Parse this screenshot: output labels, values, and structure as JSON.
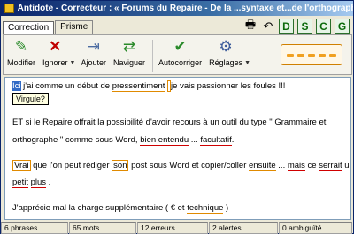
{
  "window": {
    "title": "Antidote - Correcteur : « Forums du Repaire - De la ...syntaxe et...de l'orthographe..."
  },
  "tabs": [
    {
      "label": "Correction"
    },
    {
      "label": "Prisme"
    }
  ],
  "toolbar": {
    "buttons": [
      {
        "label": "Modifier",
        "icon": "modify-icon"
      },
      {
        "label": "Ignorer",
        "icon": "ignore-icon"
      },
      {
        "label": "Ajouter",
        "icon": "add-icon"
      },
      {
        "label": "Naviguer",
        "icon": "navigate-icon"
      },
      {
        "label": "Autocorriger",
        "icon": "autocorrect-icon"
      },
      {
        "label": "Réglages",
        "icon": "settings-icon"
      }
    ]
  },
  "dscg": [
    "D",
    "S",
    "C",
    "G"
  ],
  "editor": {
    "tooltip": "Virgule?",
    "l1": {
      "sel": "Ici",
      "a": " j'ai comme un début de ",
      "b": "pressentiment",
      "c": " ",
      "d": "je vais passionner les foules !!!"
    },
    "l2": {
      "a": "ET si le Repaire offrait la possibilité d'avoir recours à un outil du type \" Grammaire et"
    },
    "l3": {
      "a": "orthographe \" comme sous Word, ",
      "b": "bien entendu",
      "c": " ... ",
      "d": "facultatif",
      "e": "."
    },
    "l4": {
      "a": "Vrai",
      "b": " que l'on peut rédiger ",
      "c": "son",
      "d": " post sous Word et copier/coller ",
      "e": "ensuite",
      "f": " ... ",
      "g": "mais",
      "h": " ce ",
      "i": "serrait",
      "j": " un"
    },
    "l5": {
      "a": "petit",
      "b": " ",
      "c": "plus",
      "d": " ."
    },
    "l6": {
      "a": "J'apprécie mal la charge supplémentaire ( € et ",
      "b": "technique",
      "c": " )"
    }
  },
  "status": {
    "phrases": "6 phrases",
    "mots": "65 mots",
    "erreurs": "12 erreurs",
    "alertes": "2 alertes",
    "ambiguite": "0 ambiguïté"
  },
  "colors": {
    "title_bar": "#0a246a",
    "error_underline": "#d00000",
    "alert_underline": "#e08a00",
    "dscg_green": "#0a6a0a"
  }
}
